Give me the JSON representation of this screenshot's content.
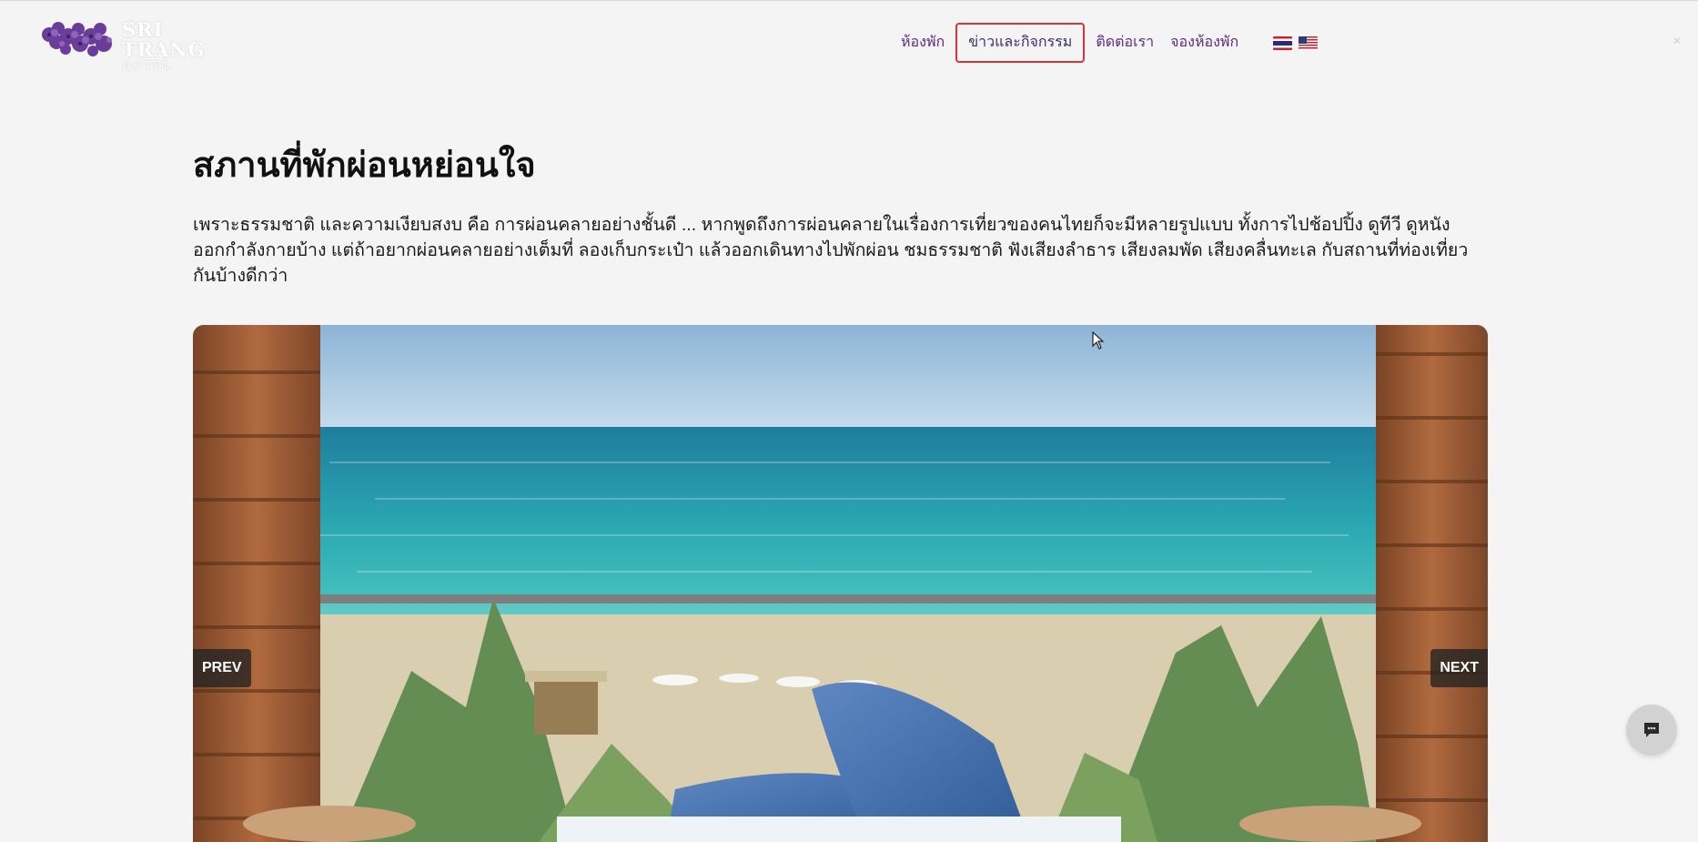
{
  "brand": {
    "name": "SRI TRANG",
    "subtitle": "HOTEL"
  },
  "nav": {
    "items": [
      {
        "label": "ห้องพัก",
        "active": false
      },
      {
        "label": "ข่าวและกิจกรรม",
        "active": true
      },
      {
        "label": "ติดต่อเรา",
        "active": false
      },
      {
        "label": "จองห้องพัก",
        "active": false
      }
    ],
    "languages": [
      {
        "code": "th",
        "icon": "thai-flag-icon"
      },
      {
        "code": "en",
        "icon": "us-flag-icon"
      }
    ]
  },
  "article": {
    "title": "สภานที่พักผ่อนหย่อนใจ",
    "intro": "เพราะธรรมชาติ และความเงียบสงบ คือ การผ่อนคลายอย่างชั้นดี ... หากพูดถึงการผ่อนคลายในเรื่องการเที่ยวของคนไทยก็จะมีหลายรูปแบบ ทั้งการไปช้อปปิ้ง ดูทีวี ดูหนัง ออกกำลังกายบ้าง แต่ถ้าอยากผ่อนคลายอย่างเต็มที่ ลองเก็บกระเป๋า แล้วออกเดินทางไปพักผ่อน ชมธรรมชาติ ฟังเสียงลำธาร เสียงลมพัด เสียงคลื่นทะเล กับสถานที่ท่องเที่ยวกันบ้างดีกว่า"
  },
  "slider": {
    "prev_label": "PREV",
    "next_label": "NEXT"
  },
  "colors": {
    "background": "#f4f4f4",
    "nav_text": "#5c2a86",
    "active_border": "#d9343a",
    "slider_button": "#232323"
  },
  "icons": {
    "chat": "chat-bubble-icon",
    "cursor": "mouse-pointer-icon"
  }
}
